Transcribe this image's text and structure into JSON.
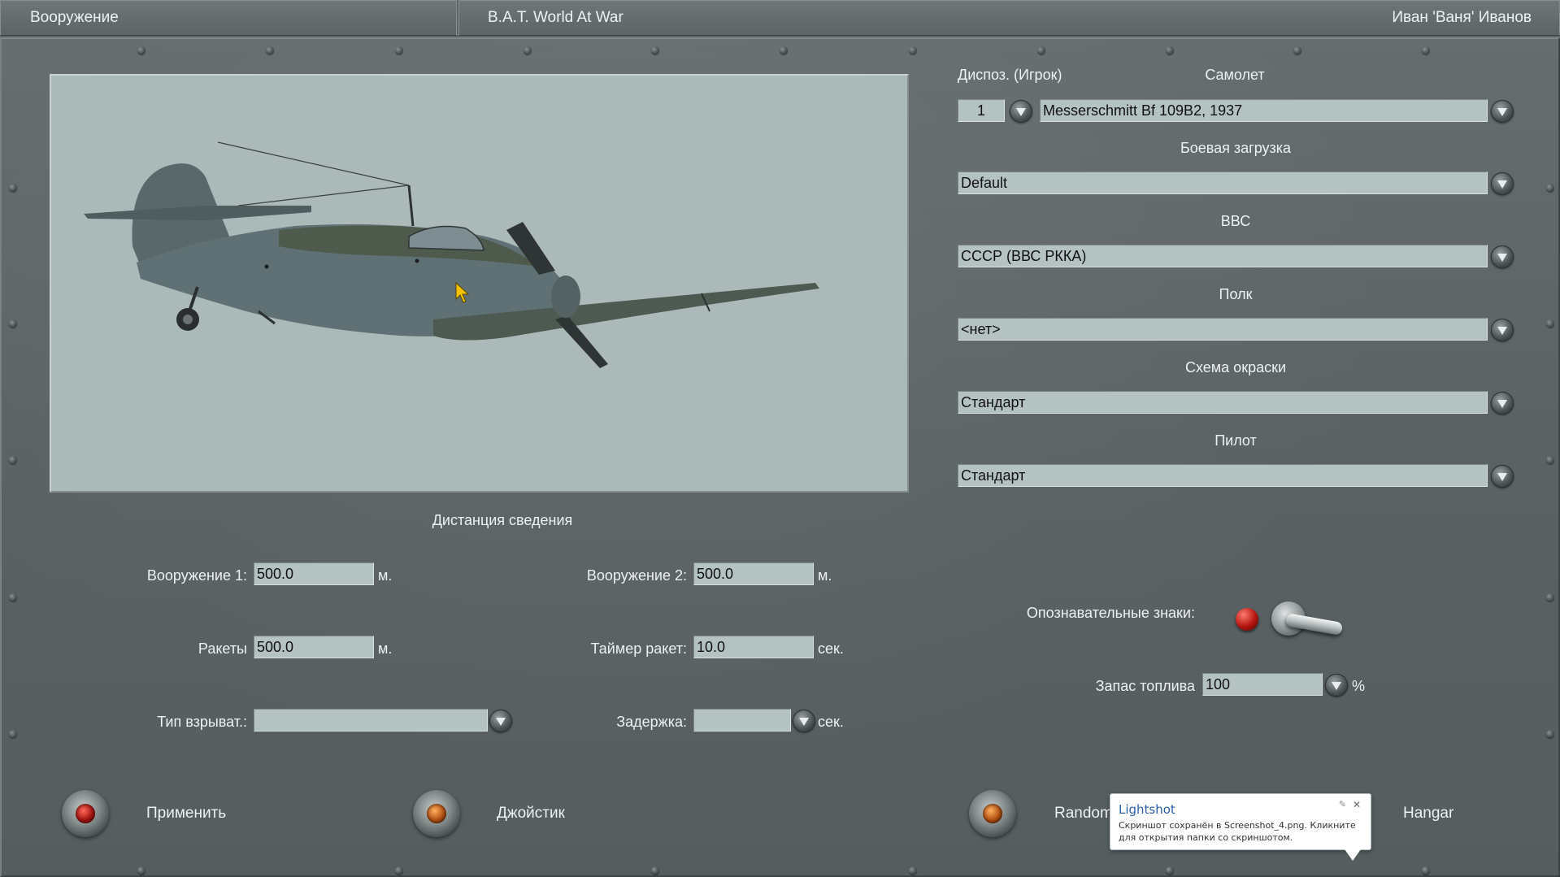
{
  "titlebar": {
    "section": "Вооружение",
    "app": "B.A.T. World At War",
    "user": "Иван 'Ваня' Иванов"
  },
  "aircraft": {
    "dispos_label": "Диспоз. (Игрок)",
    "dispos_value": "1",
    "plane_label": "Самолет",
    "plane_value": "Messerschmitt Bf 109B2, 1937",
    "loadout_label": "Боевая загрузка",
    "loadout_value": "Default",
    "airforce_label": "ВВС",
    "airforce_value": "СССР (ВВС РККА)",
    "regiment_label": "Полк",
    "regiment_value": "<нет>",
    "skin_label": "Схема окраски",
    "skin_value": "Стандарт",
    "pilot_label": "Пилот",
    "pilot_value": "Стандарт"
  },
  "convergence": {
    "title": "Дистанция сведения",
    "weapon1_label": "Вооружение 1:",
    "weapon1_value": "500.0",
    "weapon2_label": "Вооружение 2:",
    "weapon2_value": "500.0",
    "rockets_label": "Ракеты",
    "rockets_value": "500.0",
    "rocket_timer_label": "Таймер ракет:",
    "rocket_timer_value": "10.0",
    "fuze_label": "Тип взрыват.:",
    "fuze_value": "",
    "delay_label": "Задержка:",
    "delay_value": "",
    "unit_m": "м.",
    "unit_sec": "сек."
  },
  "markings": {
    "label": "Опознавательные знаки:"
  },
  "fuel": {
    "label": "Запас топлива",
    "value": "100",
    "unit": "%"
  },
  "buttons": {
    "apply": "Применить",
    "joystick": "Джойстик",
    "random": "Random",
    "hangar": "Hangar"
  },
  "notification": {
    "title": "Lightshot",
    "text": "Скриншот сохранён в Screenshot_4.png. Кликните для открытия папки со скриншотом."
  },
  "colors": {
    "panel": "#5d6566",
    "viewport": "#abbab9",
    "field": "#b4c2c1"
  }
}
